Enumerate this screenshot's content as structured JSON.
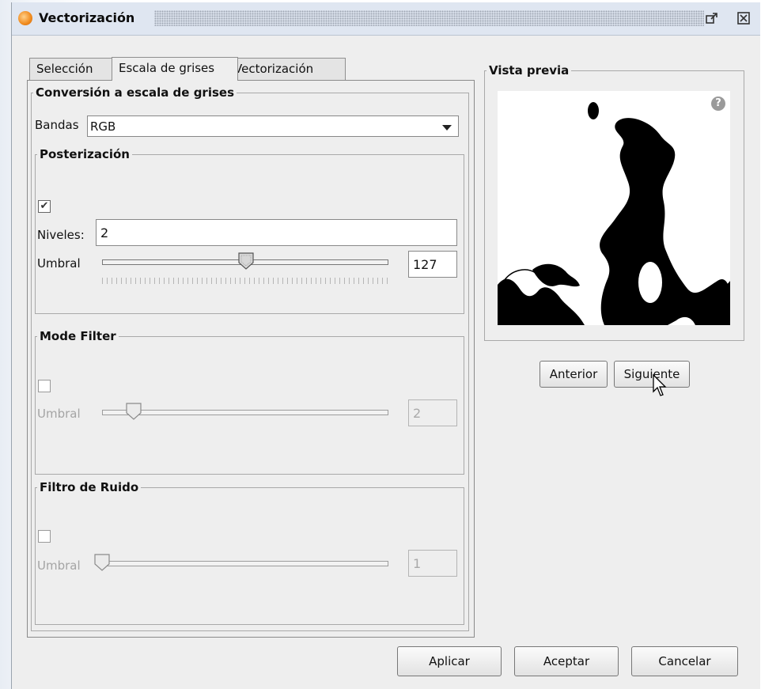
{
  "window": {
    "title": "Vectorización",
    "maximize_icon": "maximize-icon",
    "close_icon": "close-icon"
  },
  "tabs": [
    {
      "label": "Selección",
      "active": false
    },
    {
      "label": "Escala de grises",
      "active": true
    },
    {
      "label": "Vectorización",
      "active": false
    }
  ],
  "conversion": {
    "legend": "Conversión a escala de grises",
    "bands_label": "Bandas",
    "bands_value": "RGB"
  },
  "posterization": {
    "legend": "Posterización",
    "enabled": true,
    "levels_label": "Niveles:",
    "levels_value": "2",
    "threshold_label": "Umbral",
    "threshold_value": "127",
    "threshold_fraction": 0.5
  },
  "mode_filter": {
    "legend": "Mode Filter",
    "enabled": false,
    "threshold_label": "Umbral",
    "threshold_value": "2",
    "threshold_fraction": 0.12
  },
  "noise_filter": {
    "legend": "Filtro de Ruido",
    "enabled": false,
    "threshold_label": "Umbral",
    "threshold_value": "1",
    "threshold_fraction": 0.0
  },
  "preview": {
    "legend": "Vista previa",
    "help_icon": "help-icon",
    "previous_label": "Anterior",
    "next_label": "Siguiente"
  },
  "footer": {
    "apply_label": "Aplicar",
    "accept_label": "Aceptar",
    "cancel_label": "Cancelar"
  },
  "colors": {
    "titlebar": "#dfe6f1",
    "dialog_bg": "#eeeeee",
    "logo_orange": "#f08a1c"
  }
}
